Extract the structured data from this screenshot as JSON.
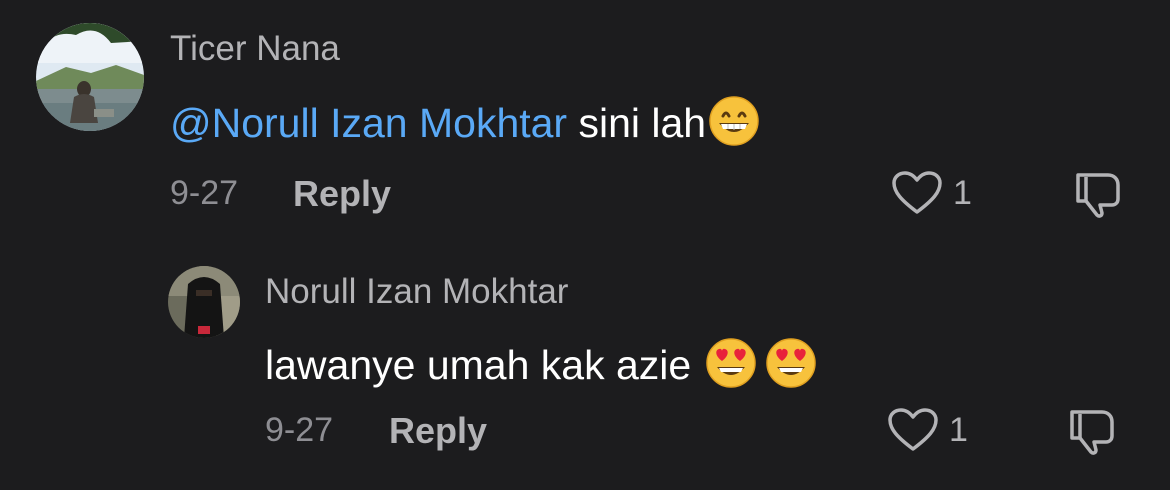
{
  "comments": [
    {
      "username": "Ticer Nana",
      "mention": "@Norull Izan Mokhtar",
      "text": " sini lah",
      "emojis": [
        "grinning-face-emoji"
      ],
      "date": "9-27",
      "reply_label": "Reply",
      "like_count": "1"
    }
  ],
  "replies": [
    {
      "username": "Norull Izan Mokhtar",
      "text": "lawanye umah kak azie ",
      "emojis": [
        "heart-eyes-emoji",
        "heart-eyes-emoji"
      ],
      "date": "9-27",
      "reply_label": "Reply",
      "like_count": "1"
    }
  ],
  "colors": {
    "background": "#1c1c1e",
    "mention": "#5aa9f6",
    "username": "#b3b3b6",
    "meta": "#8e8e93"
  }
}
